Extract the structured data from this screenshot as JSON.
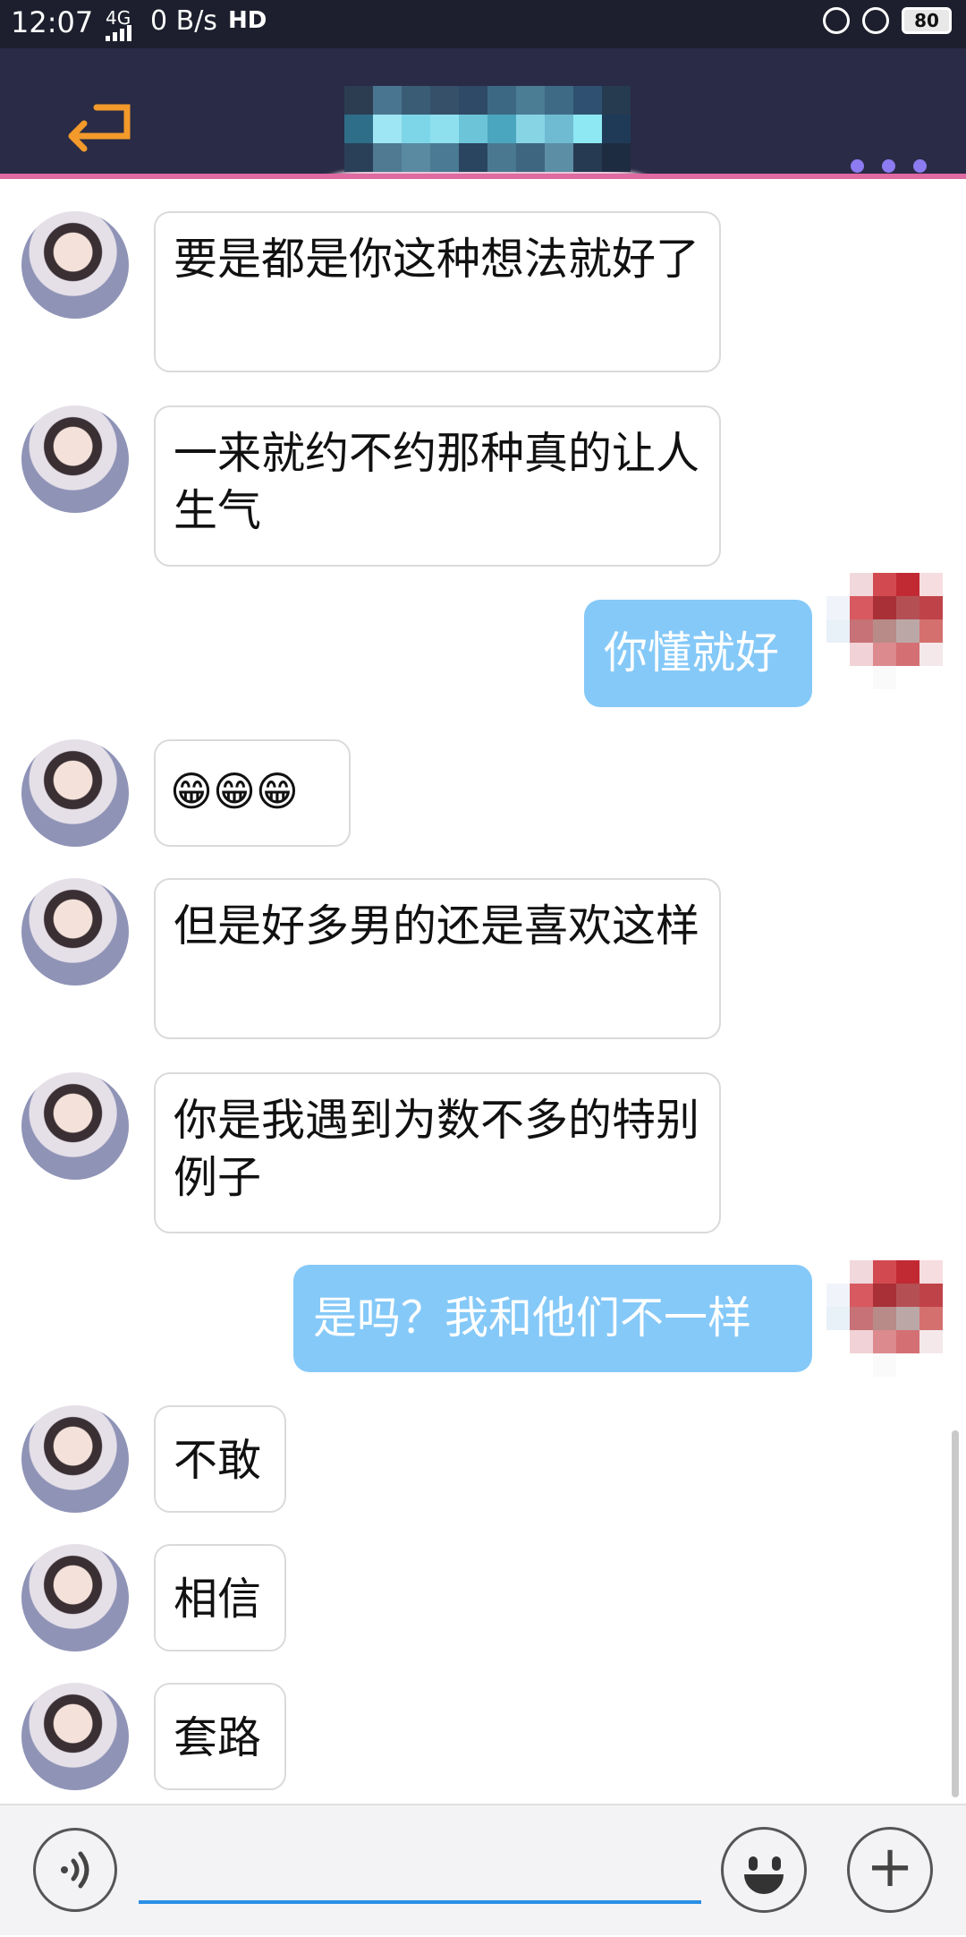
{
  "status_bar": {
    "time": "12:07",
    "network": "4G",
    "speed": "0 B/s",
    "hd": "HD",
    "battery": "80"
  },
  "header": {
    "back_icon": "back-arrow-icon",
    "more_icon": "more-dots-icon",
    "accent_color": "#e06aa2"
  },
  "messages": [
    {
      "side": "left",
      "text": "要是都是你这种想法就好了"
    },
    {
      "side": "left",
      "text": "一来就约不约那种真的让人生气"
    },
    {
      "side": "right",
      "text": "你懂就好"
    },
    {
      "side": "left",
      "text": "😁😁😁"
    },
    {
      "side": "left",
      "text": "但是好多男的还是喜欢这样"
    },
    {
      "side": "left",
      "text": "你是我遇到为数不多的特别例子"
    },
    {
      "side": "right",
      "text": "是吗？我和他们不一样"
    },
    {
      "side": "left",
      "text": "不敢"
    },
    {
      "side": "left",
      "text": "相信"
    },
    {
      "side": "left",
      "text": "套路"
    }
  ],
  "input_bar": {
    "voice_icon": "voice-icon",
    "emoji_icon": "emoji-icon",
    "plus_icon": "plus-icon",
    "input_value": ""
  },
  "colors": {
    "header_bg": "#2a2b46",
    "my_bubble": "#85c9f8",
    "more_dots": "#8d7bf2"
  }
}
